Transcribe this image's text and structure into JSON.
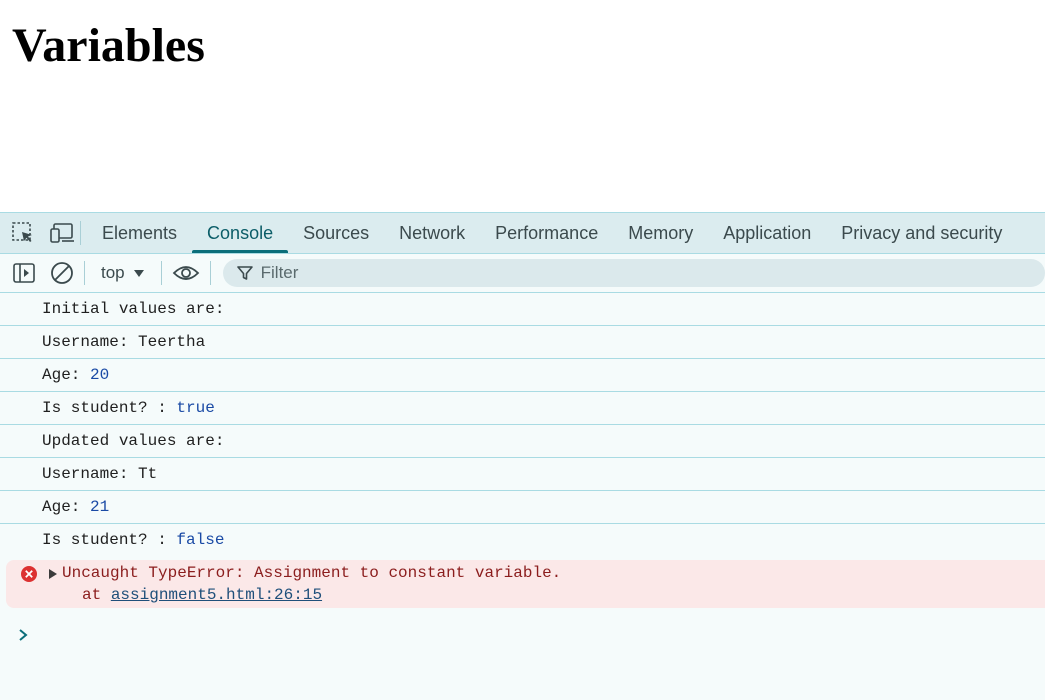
{
  "page": {
    "heading": "Variables"
  },
  "devtools": {
    "tabs": [
      {
        "label": "Elements"
      },
      {
        "label": "Console"
      },
      {
        "label": "Sources"
      },
      {
        "label": "Network"
      },
      {
        "label": "Performance"
      },
      {
        "label": "Memory"
      },
      {
        "label": "Application"
      },
      {
        "label": "Privacy and security"
      }
    ],
    "active_tab": "Console",
    "toolbar": {
      "context": "top",
      "filter_placeholder": "Filter"
    },
    "console": {
      "logs": [
        {
          "text": "Initial values are:",
          "value": ""
        },
        {
          "text": "Username: Teertha",
          "value": ""
        },
        {
          "text": "Age: ",
          "value": "20"
        },
        {
          "text": "Is student? : ",
          "value": "true"
        },
        {
          "text": "Updated values are:",
          "value": ""
        },
        {
          "text": "Username: Tt",
          "value": ""
        },
        {
          "text": "Age: ",
          "value": "21"
        },
        {
          "text": "Is student? : ",
          "value": "false"
        }
      ],
      "error": {
        "message": "Uncaught TypeError: Assignment to constant variable.",
        "at_prefix": "at ",
        "location": "assignment5.html:26:15"
      }
    }
  }
}
